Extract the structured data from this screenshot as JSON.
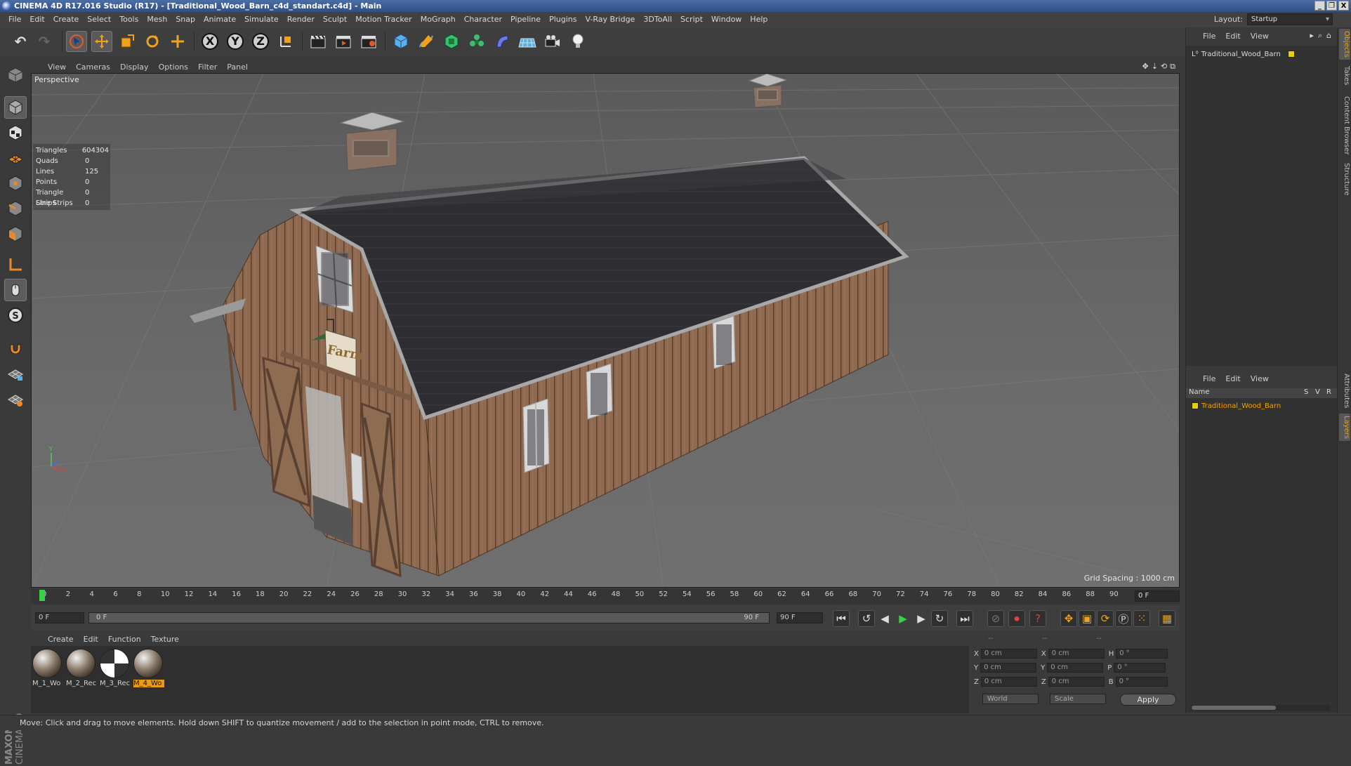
{
  "window": {
    "title": "CINEMA 4D R17.016 Studio (R17) - [Traditional_Wood_Barn_c4d_standart.c4d] - Main",
    "buttons": [
      "_",
      "❐",
      "X"
    ]
  },
  "menu": [
    "File",
    "Edit",
    "Create",
    "Select",
    "Tools",
    "Mesh",
    "Snap",
    "Animate",
    "Simulate",
    "Render",
    "Sculpt",
    "Motion Tracker",
    "MoGraph",
    "Character",
    "Pipeline",
    "Plugins",
    "V-Ray Bridge",
    "3DToAll",
    "Script",
    "Window",
    "Help"
  ],
  "layout": {
    "label": "Layout:",
    "value": "Startup"
  },
  "toolbar": {
    "undo": "↶",
    "redo": "↷",
    "axes": [
      "X",
      "Y",
      "Z"
    ]
  },
  "viewport": {
    "menu": [
      "View",
      "Cameras",
      "Display",
      "Options",
      "Filter",
      "Panel"
    ],
    "camera_label": "Perspective",
    "stats": [
      {
        "label": "Triangles",
        "value": "604304"
      },
      {
        "label": "Quads",
        "value": "0"
      },
      {
        "label": "Lines",
        "value": "125"
      },
      {
        "label": "Points",
        "value": "0"
      },
      {
        "label": "Triangle Strips",
        "value": "0"
      },
      {
        "label": "Line Strips",
        "value": "0"
      }
    ],
    "grid_spacing": "Grid Spacing : 1000 cm",
    "sign_text": "Farm"
  },
  "timeline": {
    "ticks": [
      "0",
      "2",
      "4",
      "6",
      "8",
      "10",
      "12",
      "14",
      "16",
      "18",
      "20",
      "22",
      "24",
      "26",
      "28",
      "30",
      "32",
      "34",
      "36",
      "38",
      "40",
      "42",
      "44",
      "46",
      "48",
      "50",
      "52",
      "54",
      "56",
      "58",
      "60",
      "62",
      "64",
      "66",
      "68",
      "70",
      "72",
      "74",
      "76",
      "78",
      "80",
      "82",
      "84",
      "86",
      "88",
      "90"
    ],
    "current_frame": "0 F",
    "start": "0 F",
    "slider_start": "0 F",
    "slider_end": "90 F",
    "end": "90 F"
  },
  "materials": {
    "menu": [
      "Create",
      "Edit",
      "Function",
      "Texture"
    ],
    "items": [
      {
        "name": "M_1_Wo",
        "selected": false
      },
      {
        "name": "M_2_Rec",
        "selected": false
      },
      {
        "name": "M_3_Rec",
        "selected": false
      },
      {
        "name": "M_4_Wo",
        "selected": true
      }
    ]
  },
  "coordinates": {
    "headers": [
      "--",
      "--",
      "--"
    ],
    "rows": [
      {
        "a": "X",
        "av": "0 cm",
        "b": "X",
        "bv": "0 cm",
        "c": "H",
        "cv": "0 °"
      },
      {
        "a": "Y",
        "av": "0 cm",
        "b": "Y",
        "bv": "0 cm",
        "c": "P",
        "cv": "0 °"
      },
      {
        "a": "Z",
        "av": "0 cm",
        "b": "Z",
        "bv": "0 cm",
        "c": "B",
        "cv": "0 °"
      }
    ],
    "space": "World",
    "mode": "Scale",
    "apply": "Apply"
  },
  "status": "Move: Click and drag to move elements. Hold down SHIFT to quantize movement / add to the selection in point mode, CTRL to remove.",
  "objects_panel": {
    "menu": [
      "File",
      "Edit",
      "View"
    ],
    "object": "Traditional_Wood_Barn"
  },
  "layers_panel": {
    "menu": [
      "File",
      "Edit",
      "View"
    ],
    "columns": [
      "Name",
      "S",
      "V",
      "R"
    ],
    "layer": "Traditional_Wood_Barn"
  },
  "right_tabs": [
    "Objects",
    "Takes",
    "Content Browser",
    "Structure",
    "Attributes",
    "Layers"
  ],
  "maxon_logo": [
    "MAXON",
    "CINEMA 4D"
  ]
}
